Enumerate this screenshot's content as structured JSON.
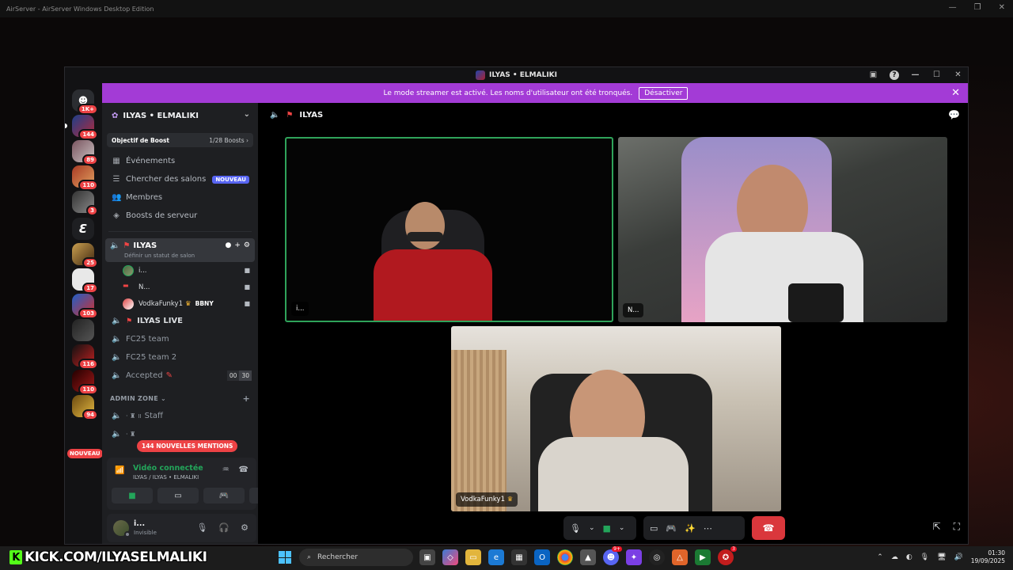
{
  "airserver": {
    "title": "AirServer - AirServer Windows Desktop Edition"
  },
  "discord": {
    "window_title": "ILYAS • ELMALIKI",
    "banner": {
      "text": "Le mode streamer est activé. Les noms d'utilisateur ont été tronqués.",
      "button": "Désactiver"
    },
    "rail": {
      "badges": [
        "1K+",
        "144",
        "89",
        "110",
        "3",
        "",
        "25",
        "17",
        "103",
        "",
        "116",
        "110",
        "94"
      ],
      "new_tag": "NOUVEAU"
    },
    "server": {
      "name": "ILYAS • ELMALIKI",
      "boost_label": "Objectif de Boost",
      "boost_count": "1/28 Boosts",
      "nav": [
        {
          "label": "Événements",
          "icon": "calendar-icon"
        },
        {
          "label": "Chercher des salons",
          "icon": "channel-browse-icon",
          "tag": "NOUVEAU"
        },
        {
          "label": "Membres",
          "icon": "members-icon"
        },
        {
          "label": "Boosts de serveur",
          "icon": "boost-icon"
        }
      ],
      "active_voice": {
        "name": "ILYAS",
        "status_hint": "Définir un statut de salon"
      },
      "members": [
        {
          "name": "i..."
        },
        {
          "name": "N..."
        },
        {
          "name": "VodkaFunky1",
          "tag": "BBNY"
        }
      ],
      "channels": [
        {
          "name": "ILYAS LIVE",
          "bold": true
        },
        {
          "name": "FC25 team"
        },
        {
          "name": "FC25 team 2"
        },
        {
          "name": "Accepted",
          "count_a": "00",
          "count_b": "30"
        }
      ],
      "category": "ADMIN ZONE",
      "admin_channels": [
        "Staff",
        ""
      ],
      "mentions_pill": "144 NOUVELLES MENTIONS"
    },
    "voice_panel": {
      "title": "Vidéo connectée",
      "sub": "ILYAS / ILYAS • ELMALIKI"
    },
    "user_panel": {
      "name": "i...",
      "status": "Invisible"
    },
    "main": {
      "channel_name": "ILYAS",
      "tiles": [
        {
          "label": "i..."
        },
        {
          "label": "N..."
        },
        {
          "label": "VodkaFunky1"
        }
      ]
    },
    "colors": {
      "banner": "#a33bd6",
      "speaking": "#2fa35a",
      "connected": "#23a55a",
      "end_call": "#da373c"
    }
  },
  "taskbar": {
    "kick_text": "KICK.COM/ILYASELMALIKI",
    "search_placeholder": "Rechercher",
    "time": "01:30",
    "date": "19/09/2025"
  }
}
